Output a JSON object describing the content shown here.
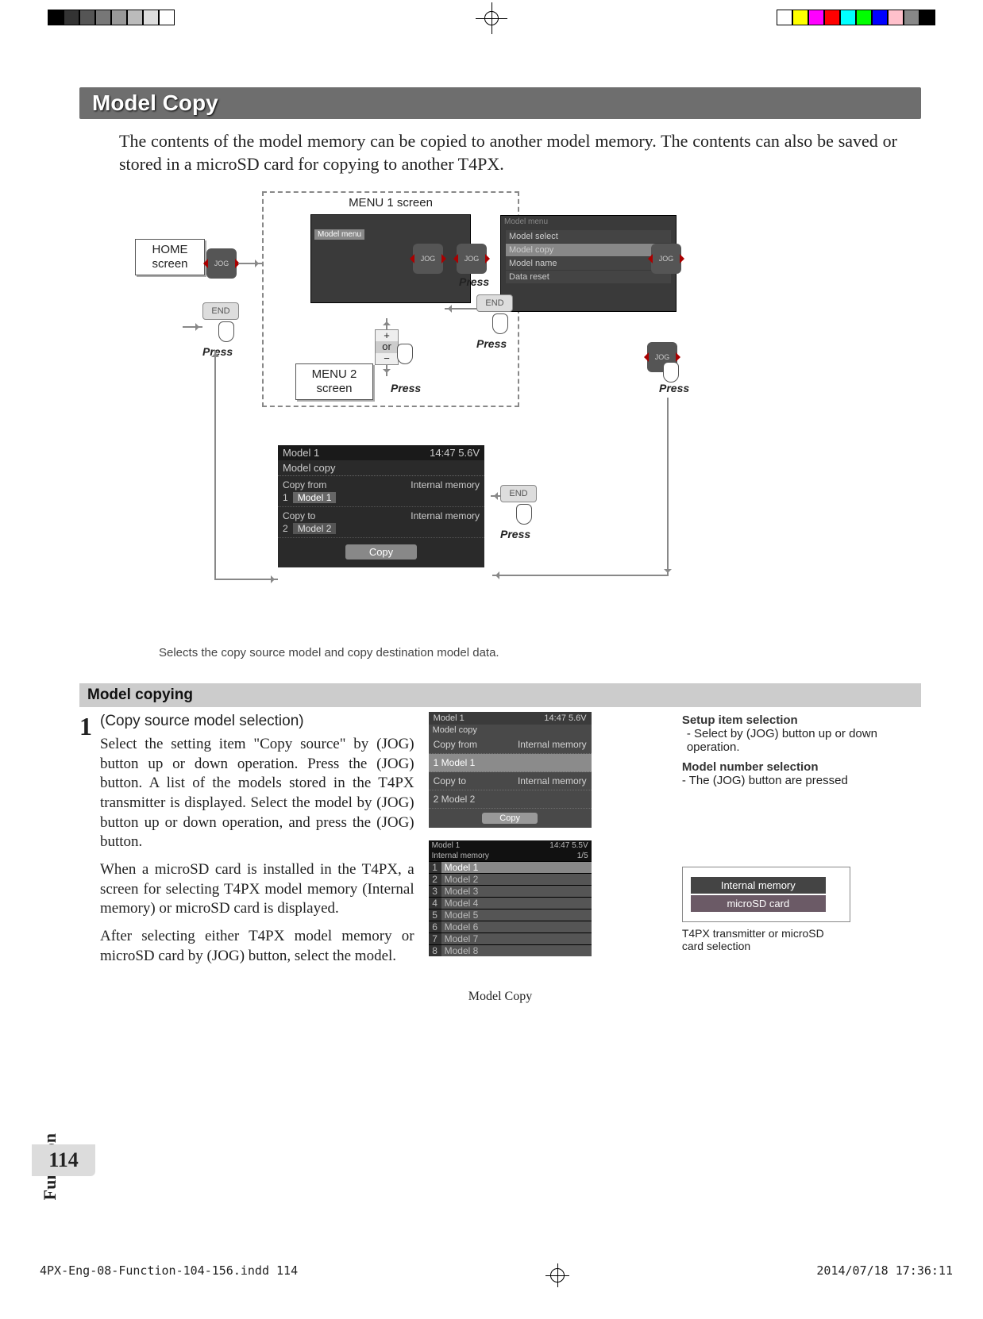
{
  "regbar": {
    "left_colors": [
      "#000",
      "#333",
      "#555",
      "#777",
      "#999",
      "#bbb",
      "#ddd",
      "#fff"
    ],
    "right_colors": [
      "#fff",
      "#ff0",
      "#f0f",
      "#f00",
      "#0ff",
      "#0f0",
      "#00f",
      "#ffc0cb",
      "#888",
      "#000"
    ]
  },
  "title": "Model Copy",
  "intro": "The contents of the model memory can be copied to another model memory. The contents can also be saved or stored in a microSD card for copying to another T4PX.",
  "diagram": {
    "home_box": "HOME\nscreen",
    "menu1_label": "MENU 1 screen",
    "menu2_box": "MENU 2\nscreen",
    "jog_label": "JOG",
    "end_label": "END",
    "press_label": "Press",
    "plus_or_minus": [
      "+",
      "or",
      "−"
    ],
    "model_menu_items": [
      "Model select",
      "Model copy",
      "Model name",
      "Data reset"
    ],
    "caption": "Selects the copy source model and copy destination model data."
  },
  "copy_screen": {
    "hdr_left": "Model 1",
    "hdr_right": "14:47 5.6V",
    "title": "Model copy",
    "from_label": "Copy from",
    "from_mem": "Internal memory",
    "from_num": "1",
    "from_name": "Model 1",
    "to_label": "Copy to",
    "to_mem": "Internal memory",
    "to_num": "2",
    "to_name": "Model 2",
    "btn": "Copy"
  },
  "sub_heading": "Model copying",
  "step1": {
    "num": "1",
    "head": "(Copy source model selection)",
    "p1": "Select the setting item \"Copy source\" by (JOG) button up or down operation. Press the (JOG) button. A list of the models stored in the T4PX transmitter is displayed. Select the model by (JOG) button up or down operation, and press the (JOG) button.",
    "p2": "When a microSD card is installed in the T4PX, a screen for selecting T4PX model memory (Internal memory) or microSD card is displayed.",
    "p3": "After selecting either T4PX model memory or microSD card by (JOG) button, select the model."
  },
  "mid_copy_small": {
    "hdr_left": "Model 1",
    "hdr_right": "14:47 5.6V",
    "title": "Model copy",
    "from": "Copy from",
    "from_mem": "Internal memory",
    "row1": "1   Model 1",
    "to": "Copy to",
    "to_mem": "Internal memory",
    "row2": "2   Model 2",
    "btn": "Copy"
  },
  "model_list": {
    "hdr_left": "Model 1",
    "hdr_right": "14:47 5.5V",
    "sub": "Internal memory",
    "page": "1/5",
    "rows": [
      {
        "n": "1",
        "t": "Model 1"
      },
      {
        "n": "2",
        "t": "Model 2"
      },
      {
        "n": "3",
        "t": "Model 3"
      },
      {
        "n": "4",
        "t": "Model 4"
      },
      {
        "n": "5",
        "t": "Model 5"
      },
      {
        "n": "6",
        "t": "Model 6"
      },
      {
        "n": "7",
        "t": "Model 7"
      },
      {
        "n": "8",
        "t": "Model 8"
      }
    ]
  },
  "right_col": {
    "h1": "Setup item selection",
    "l1": "- Select by (JOG) button up or down operation.",
    "h2": "Model number selection",
    "l2": "- The (JOG) button are pressed",
    "mem1": "Internal memory",
    "mem2": "microSD card",
    "cap": "T4PX transmitter or microSD card selection"
  },
  "side_tab": "Function",
  "page_number": "114",
  "footer_title": "Model Copy",
  "print_footer": {
    "left": "4PX-Eng-08-Function-104-156.indd   114",
    "right": "2014/07/18   17:36:11"
  }
}
